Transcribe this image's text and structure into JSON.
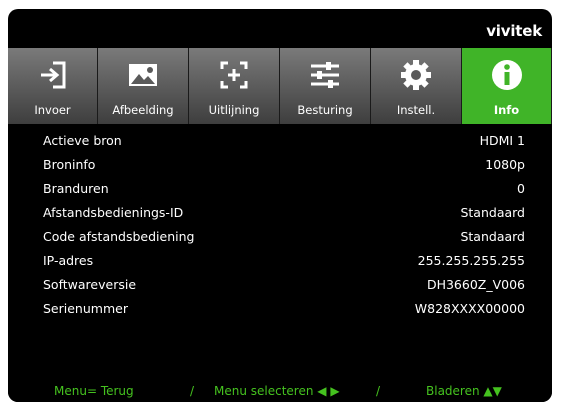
{
  "brand": "vivitek",
  "tabs": [
    {
      "label": "Invoer",
      "icon": "input-icon"
    },
    {
      "label": "Afbeelding",
      "icon": "image-icon"
    },
    {
      "label": "Uitlijning",
      "icon": "alignment-icon"
    },
    {
      "label": "Besturing",
      "icon": "sliders-icon"
    },
    {
      "label": "Instell.",
      "icon": "gear-icon"
    },
    {
      "label": "Info",
      "icon": "info-icon",
      "active": true
    }
  ],
  "info_rows": [
    {
      "label": "Actieve bron",
      "value": "HDMI 1"
    },
    {
      "label": "Broninfo",
      "value": "1080p"
    },
    {
      "label": "Branduren",
      "value": "0"
    },
    {
      "label": "Afstandsbedienings-ID",
      "value": "Standaard"
    },
    {
      "label": "Code afstandsbediening",
      "value": "Standaard"
    },
    {
      "label": "IP-adres",
      "value": "255.255.255.255"
    },
    {
      "label": "Softwareversie",
      "value": "DH3660Z_V006"
    },
    {
      "label": "Serienummer",
      "value": "W828XXXX00000"
    }
  ],
  "footer": {
    "menu_back": "Menu= Terug",
    "sep1": "/",
    "menu_select": "Menu selecteren ◀ ▶",
    "sep2": "/",
    "scroll": "Bladeren ▲▼"
  },
  "colors": {
    "active_tab": "#40b428",
    "footer_text": "#45c21f",
    "background": "#000000"
  }
}
